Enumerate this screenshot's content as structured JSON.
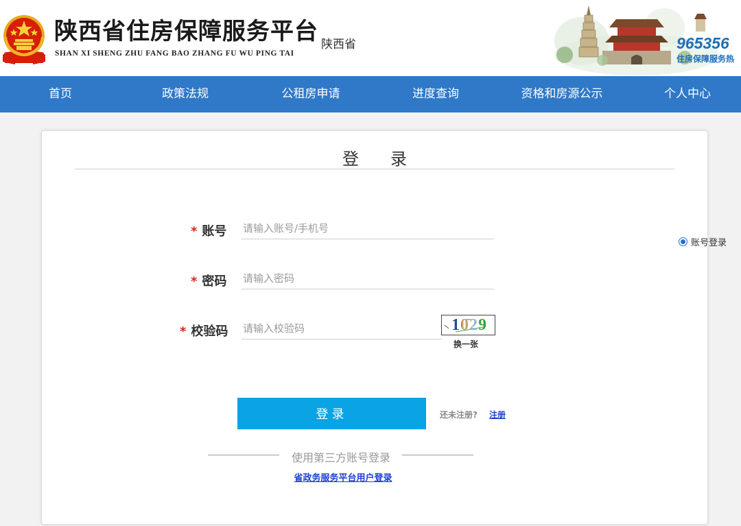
{
  "header": {
    "site_title": "陕西省住房保障服务平台",
    "site_subtitle": "SHAN XI SHENG ZHU FANG BAO ZHANG FU WU PING TAI",
    "region": "陕西省",
    "hotline_number": "965356",
    "hotline_label": "住房保障服务热"
  },
  "nav": {
    "items": [
      {
        "label": "首页"
      },
      {
        "label": "政策法规"
      },
      {
        "label": "公租房申请"
      },
      {
        "label": "进度查询"
      },
      {
        "label": "资格和房源公示"
      },
      {
        "label": "个人中心"
      }
    ]
  },
  "login": {
    "title": "登录",
    "required_mark": "*",
    "account_label": "账号",
    "account_placeholder": "请输入账号/手机号",
    "password_label": "密码",
    "password_placeholder": "请输入密码",
    "captcha_label": "校验码",
    "captcha_placeholder": "请输入校验码",
    "captcha_text": "1029",
    "captcha_refresh": "换一张",
    "login_mode": "账号登录",
    "submit_label": "登录",
    "no_account_text": "还未注册?",
    "register_link": "注册",
    "third_party_text": "使用第三方账号登录",
    "gov_login_link": "省政务服务平台用户登录"
  },
  "colors": {
    "nav_bg": "#2f79c8",
    "button_bg": "#0aa3e3",
    "link": "#1a3fd1",
    "required": "#d9221f"
  }
}
